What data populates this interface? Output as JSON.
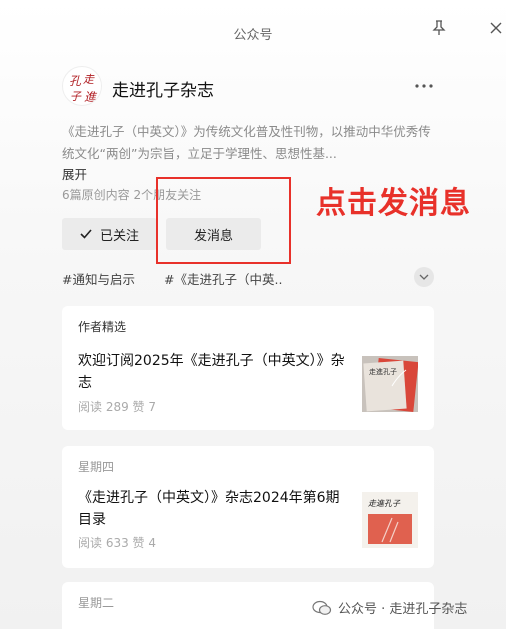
{
  "window": {
    "title": "公众号"
  },
  "account": {
    "name": "走进孔子杂志",
    "avatar_text": "孔走子進",
    "intro": "《走进孔子（中英文）》为传统文化普及性刊物，以推动中华优秀传统文化“两创”为宗旨，立足于学理性、思想性基...",
    "expand_label": "展开",
    "stats": "6篇原创内容  2个朋友关注"
  },
  "actions": {
    "followed_label": "已关注",
    "message_label": "发消息"
  },
  "annotation": {
    "text": "点击发消息",
    "color": "#e8312a"
  },
  "tags": [
    "#通知与启示",
    "#《走进孔子（中英..."
  ],
  "cards": [
    {
      "label": "作者精选",
      "title": "欢迎订阅2025年《走进孔子（中英文）》杂志",
      "stats": "阅读 289  赞 7",
      "thumb_text": "走進孔子"
    },
    {
      "label": "星期四",
      "title": "《走进孔子（中英文）》杂志2024年第6期目录",
      "stats": "阅读 633  赞 4",
      "thumb_text": "走進孔子"
    },
    {
      "label": "星期二"
    }
  ],
  "watermark": {
    "text": "公众号 · 走进孔子杂志"
  },
  "colors": {
    "accent_red": "#e8312a",
    "button_bg": "#ebebeb",
    "card_bg": "#ffffff"
  }
}
